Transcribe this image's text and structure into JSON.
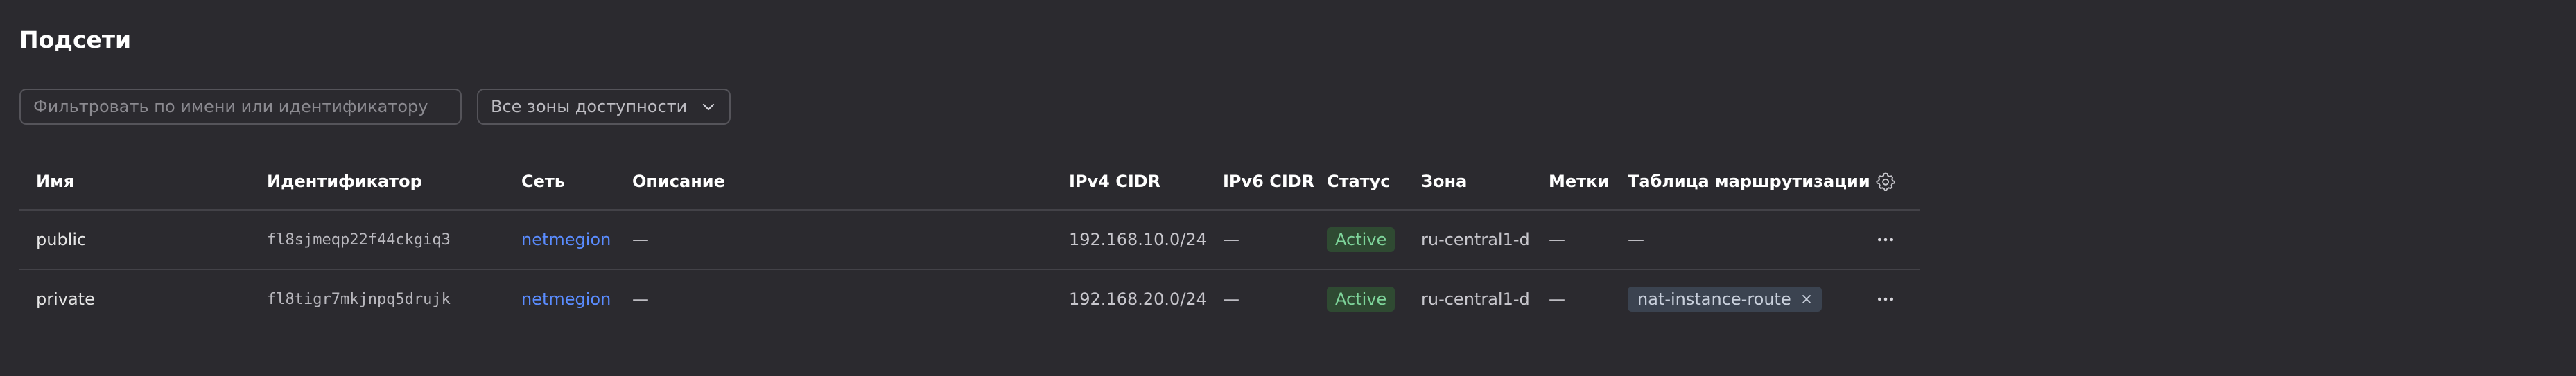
{
  "page": {
    "title": "Подсети"
  },
  "filters": {
    "search_placeholder": "Фильтровать по имени или идентификатору",
    "zone_select_value": "Все зоны доступности"
  },
  "table": {
    "columns": {
      "name": "Имя",
      "id": "Идентификатор",
      "network": "Сеть",
      "description": "Описание",
      "ipv4": "IPv4 CIDR",
      "ipv6": "IPv6 CIDR",
      "status": "Статус",
      "zone": "Зона",
      "labels": "Метки",
      "route_table": "Таблица маршрутизации"
    },
    "rows": [
      {
        "name": "public",
        "id": "fl8sjmeqp22f44ckgiq3",
        "network": "netmegion",
        "description": "—",
        "ipv4": "192.168.10.0/24",
        "ipv6": "—",
        "status": "Active",
        "zone": "ru-central1-d",
        "labels": "—",
        "route_table": "—"
      },
      {
        "name": "private",
        "id": "fl8tigr7mkjnpq5drujk",
        "network": "netmegion",
        "description": "—",
        "ipv4": "192.168.20.0/24",
        "ipv6": "—",
        "status": "Active",
        "zone": "ru-central1-d",
        "labels": "—",
        "route_table": "nat-instance-route"
      }
    ]
  },
  "icons": {
    "column_settings": "gear-icon",
    "row_actions": "more-horizontal-icon",
    "zone_dropdown": "chevron-down-icon",
    "chip_remove": "close-icon"
  },
  "colors": {
    "background": "#2b2a2f",
    "link": "#5a8cff",
    "status_active_bg": "#2f4a32",
    "status_active_text": "#7ed49a",
    "chip_bg": "#3b4350"
  }
}
